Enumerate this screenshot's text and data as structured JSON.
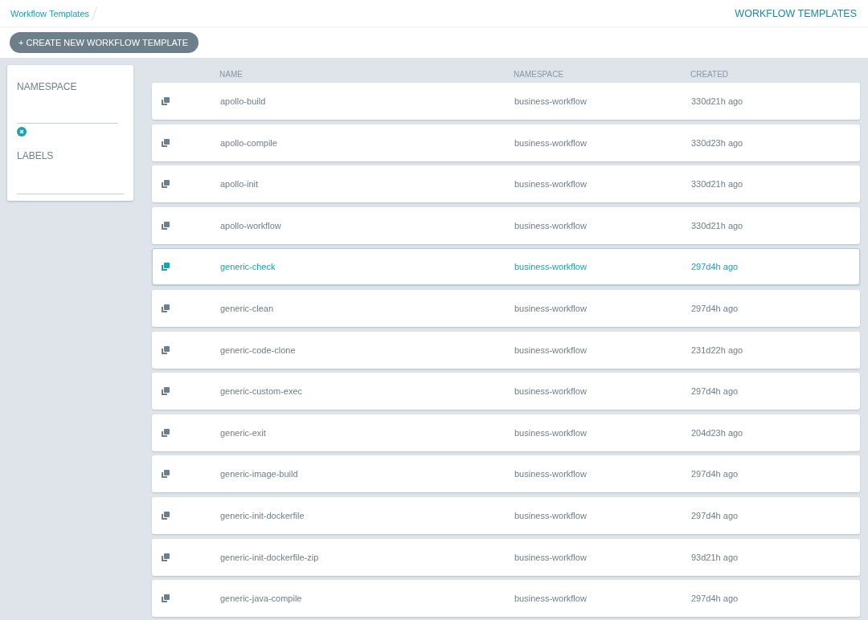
{
  "breadcrumb": "Workflow Templates",
  "page_title": "WORKFLOW TEMPLATES",
  "create_button": {
    "icon": "+",
    "label": "CREATE NEW WORKFLOW TEMPLATE"
  },
  "filters": {
    "namespace_label": "NAMESPACE",
    "labels_label": "LABELS"
  },
  "table": {
    "columns": [
      "NAME",
      "NAMESPACE",
      "CREATED"
    ],
    "rows": [
      {
        "name": "apollo-build",
        "namespace": "business-workflow",
        "created": "330d21h ago",
        "selected": false
      },
      {
        "name": "apollo-compile",
        "namespace": "business-workflow",
        "created": "330d23h ago",
        "selected": false
      },
      {
        "name": "apollo-init",
        "namespace": "business-workflow",
        "created": "330d21h ago",
        "selected": false
      },
      {
        "name": "apollo-workflow",
        "namespace": "business-workflow",
        "created": "330d21h ago",
        "selected": false
      },
      {
        "name": "generic-check",
        "namespace": "business-workflow",
        "created": "297d4h ago",
        "selected": true
      },
      {
        "name": "generic-clean",
        "namespace": "business-workflow",
        "created": "297d4h ago",
        "selected": false
      },
      {
        "name": "generic-code-clone",
        "namespace": "business-workflow",
        "created": "231d22h ago",
        "selected": false
      },
      {
        "name": "generic-custom-exec",
        "namespace": "business-workflow",
        "created": "297d4h ago",
        "selected": false
      },
      {
        "name": "generic-exit",
        "namespace": "business-workflow",
        "created": "204d23h ago",
        "selected": false
      },
      {
        "name": "generic-image-build",
        "namespace": "business-workflow",
        "created": "297d4h ago",
        "selected": false
      },
      {
        "name": "generic-init-dockerfile",
        "namespace": "business-workflow",
        "created": "297d4h ago",
        "selected": false
      },
      {
        "name": "generic-init-dockerfile-zip",
        "namespace": "business-workflow",
        "created": "93d21h ago",
        "selected": false
      },
      {
        "name": "generic-java-compile",
        "namespace": "business-workflow",
        "created": "297d4h ago",
        "selected": false
      }
    ]
  }
}
